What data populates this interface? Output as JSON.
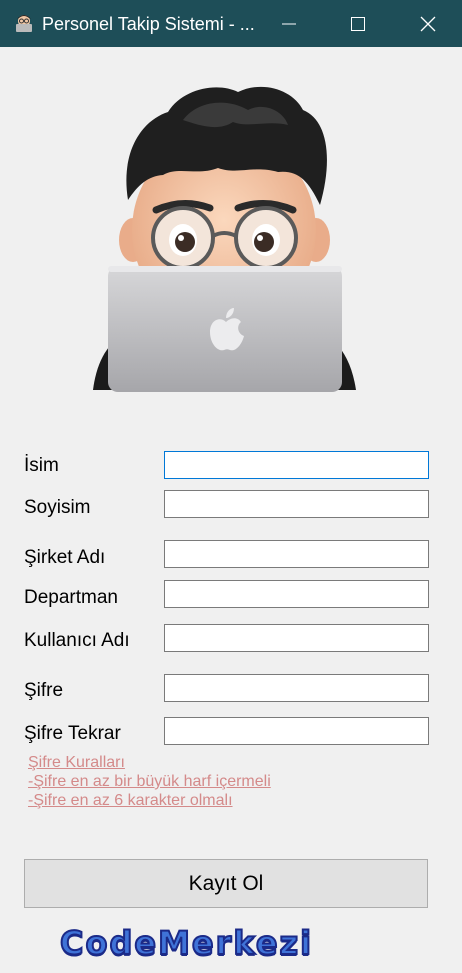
{
  "window": {
    "title": "Personel Takip Sistemi - ..."
  },
  "form": {
    "fields": [
      {
        "label": "İsim",
        "value": ""
      },
      {
        "label": "Soyisim",
        "value": ""
      },
      {
        "label": "Şirket Adı",
        "value": ""
      },
      {
        "label": "Departman",
        "value": ""
      },
      {
        "label": "Kullanıcı Adı",
        "value": ""
      },
      {
        "label": "Şifre",
        "value": ""
      },
      {
        "label": "Şifre Tekrar",
        "value": ""
      }
    ]
  },
  "rules": {
    "title": "Şifre Kuralları",
    "items": [
      "-Şifre en az bir büyük harf içermeli",
      "-Şifre en az 6 karakter olmalı"
    ]
  },
  "submit_label": "Kayıt Ol",
  "brand": "CodeMerkezi",
  "colors": {
    "titlebar": "#1e4e58",
    "rules_link": "#d48a8a",
    "focus_border": "#0078d7",
    "brand_fill": "#3f73d8",
    "brand_outline": "#1b2a88"
  }
}
